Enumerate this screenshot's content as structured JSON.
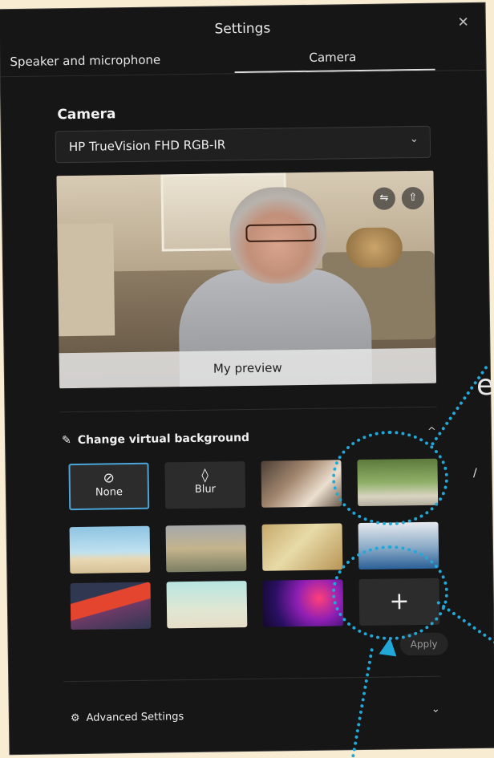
{
  "dialog": {
    "title": "Settings",
    "close_glyph": "✕"
  },
  "tabs": [
    {
      "label": "Speaker and microphone",
      "selected": false
    },
    {
      "label": "Camera",
      "selected": true
    }
  ],
  "camera": {
    "section_title": "Camera",
    "device": "HP TrueVision FHD RGB-IR",
    "dropdown_glyph": "⌄",
    "preview_label": "My preview",
    "mirror_glyph": "⇋",
    "share_glyph": "⇧"
  },
  "virtual_background": {
    "heading": "Change virtual background",
    "heading_icon": "✎",
    "collapse_glyph": "^",
    "tiles": [
      {
        "label": "None",
        "glyph": "⊘",
        "selected": true
      },
      {
        "label": "Blur",
        "glyph": "◊",
        "selected": false
      }
    ],
    "add_glyph": "+",
    "apply_label": "Apply"
  },
  "advanced": {
    "label": "Advanced Settings",
    "icon": "⚙",
    "chevron": "⌄"
  },
  "colors": {
    "panel": "#161616",
    "accent": "#4aa6d8",
    "annotation": "#22a8d8",
    "photo_background": "#f8ecd2"
  },
  "edge_text": {
    "big": "e",
    "small": "/"
  }
}
